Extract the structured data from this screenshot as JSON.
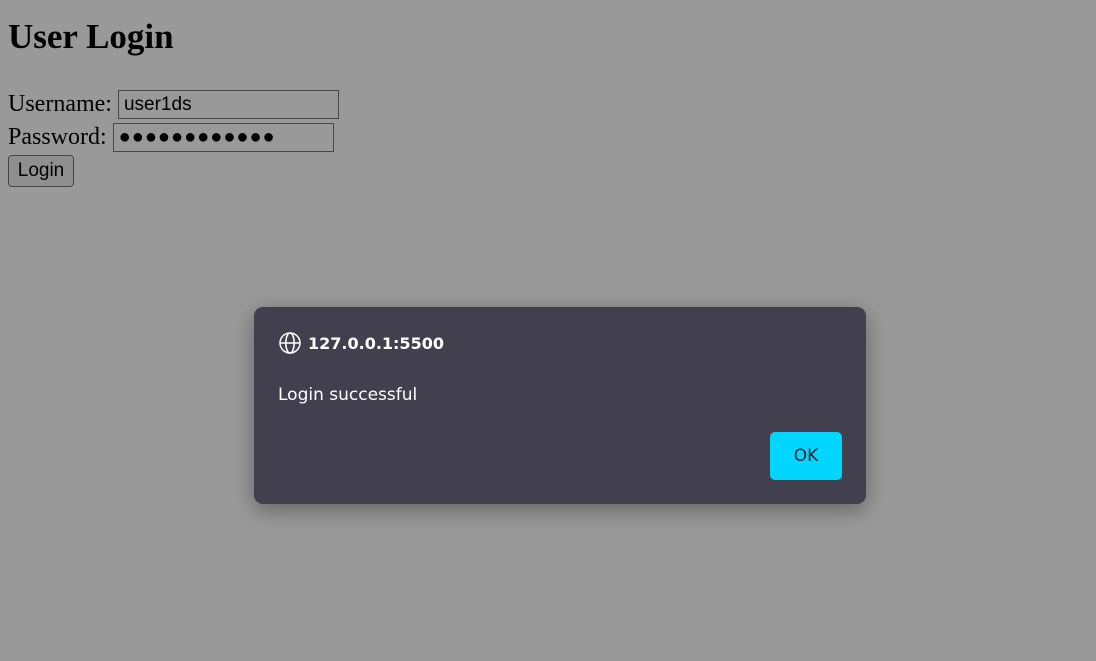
{
  "page": {
    "title": "User Login"
  },
  "form": {
    "username_label": "Username:",
    "username_value": "user1ds",
    "password_label": "Password:",
    "password_value": "●●●●●●●●●●●●",
    "login_label": "Login"
  },
  "dialog": {
    "origin": "127.0.0.1:5500",
    "message": "Login successful",
    "ok_label": "OK",
    "icon": "globe-icon",
    "accent_color": "#00d6ff",
    "background_color": "#42404e"
  }
}
